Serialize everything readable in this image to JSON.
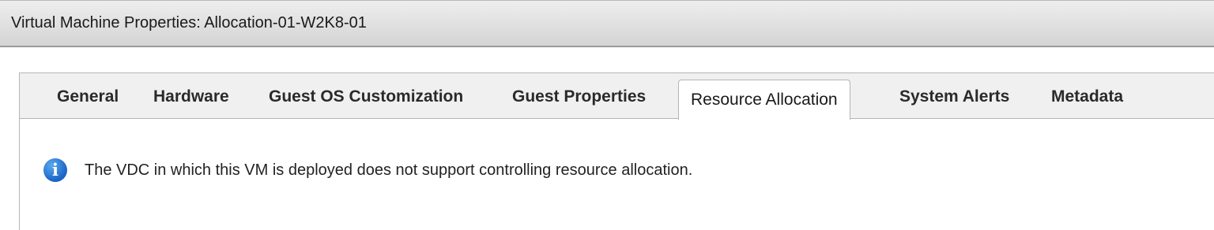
{
  "window": {
    "title": "Virtual Machine Properties: Allocation-01-W2K8-01"
  },
  "tabs": [
    {
      "label": "General",
      "active": false
    },
    {
      "label": "Hardware",
      "active": false
    },
    {
      "label": "Guest OS Customization",
      "active": false
    },
    {
      "label": "Guest Properties",
      "active": false
    },
    {
      "label": "Resource Allocation",
      "active": true
    },
    {
      "label": "System Alerts",
      "active": false
    },
    {
      "label": "Metadata",
      "active": false
    }
  ],
  "content": {
    "info_icon": "info-icon",
    "info_icon_glyph": "i",
    "info_color": "#1a63c6",
    "message": "The VDC in which this VM is deployed does not support controlling resource allocation."
  }
}
